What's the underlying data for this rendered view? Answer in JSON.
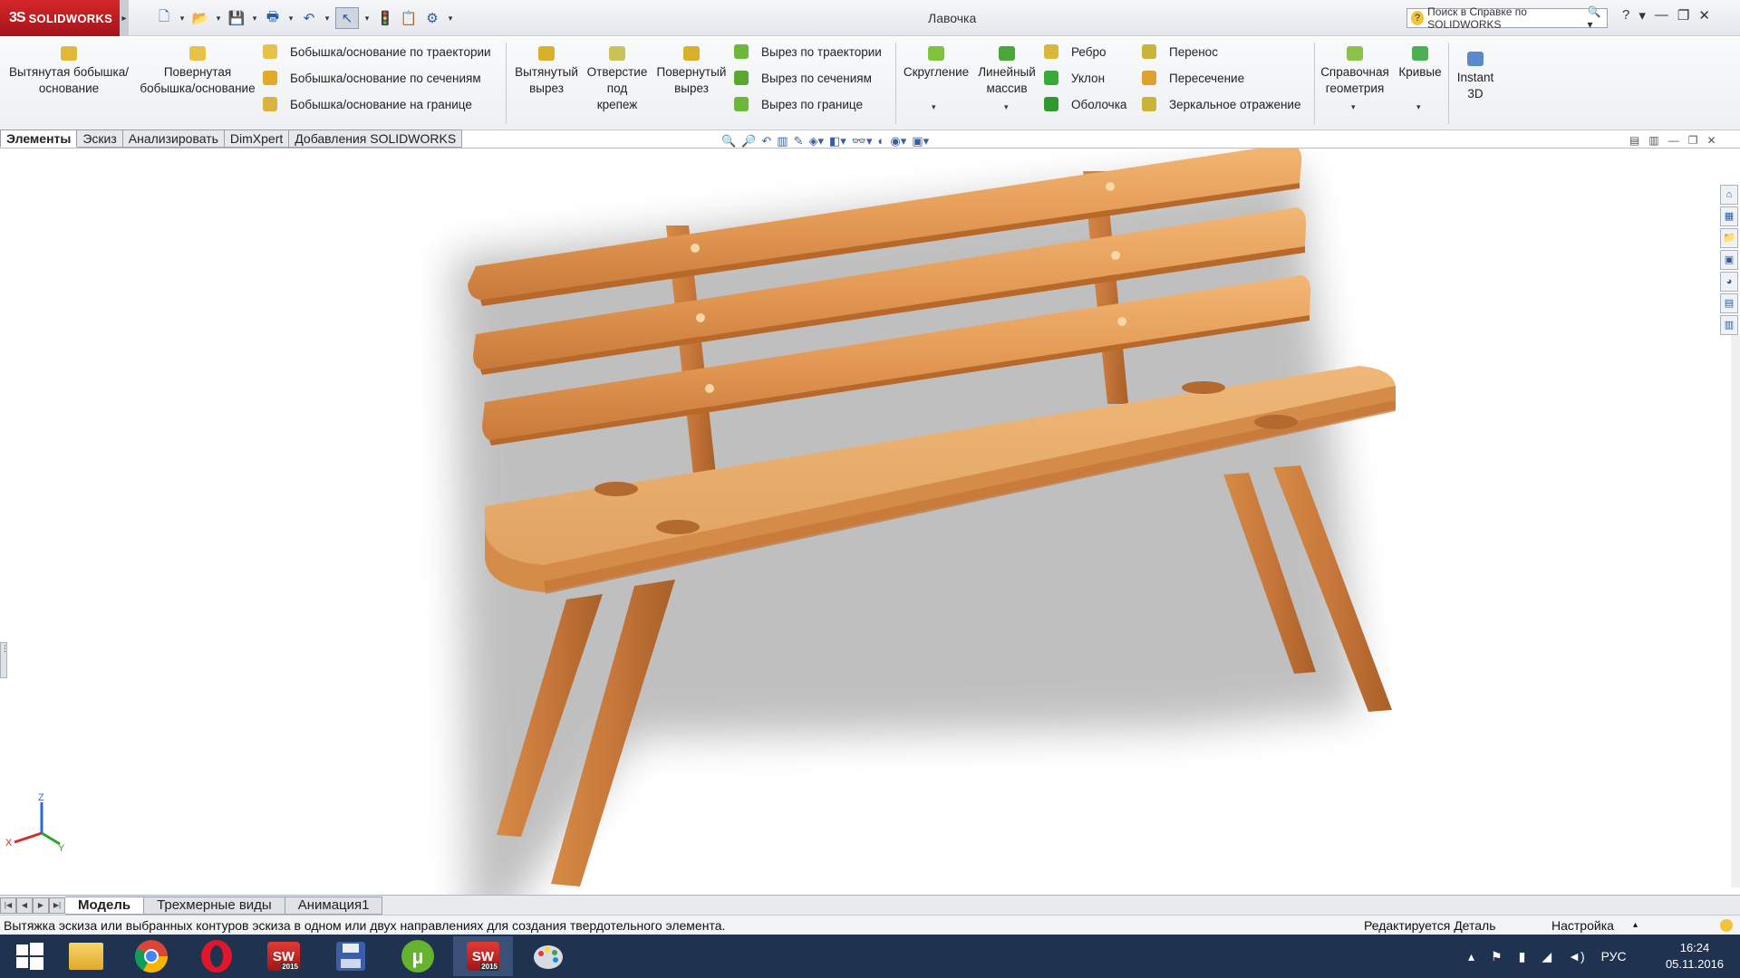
{
  "app": {
    "brand": "SOLIDWORKS",
    "ds_mark": "3S",
    "window_title": "Лавочка",
    "help_placeholder": "Поиск в Справке по SOLIDWORKS",
    "help_q": "?"
  },
  "qat": {
    "new": "🗋",
    "open": "📂",
    "save": "💾",
    "print": "🖶",
    "undo": "↶",
    "select": "↖",
    "rebuild": "🚦",
    "file_props": "📋",
    "options": "⚙"
  },
  "ribbon": {
    "extrude_boss": "Вытянутая бобышка/основание",
    "revolve_boss": "Повернутая бобышка/основание",
    "swept_boss": "Бобышка/основание по траектории",
    "lofted_boss": "Бобышка/основание по сечениям",
    "boundary_boss": "Бобышка/основание на границе",
    "extrude_cut": "Вытянутый вырез",
    "hole_wizard": "Отверстие под крепеж",
    "revolve_cut": "Повернутый вырез",
    "swept_cut": "Вырез по траектории",
    "lofted_cut": "Вырез по сечениям",
    "boundary_cut": "Вырез по границе",
    "fillet": "Скругление",
    "linear_pattern": "Линейный массив",
    "rib": "Ребро",
    "draft": "Уклон",
    "shell": "Оболочка",
    "wrap": "Перенос",
    "intersect": "Пересечение",
    "mirror": "Зеркальное отражение",
    "ref_geometry": "Справочная геометрия",
    "curves": "Кривые",
    "instant3d": "Instant 3D"
  },
  "tabs": [
    "Элементы",
    "Эскиз",
    "Анализировать",
    "DimXpert",
    "Добавления SOLIDWORKS"
  ],
  "triad": {
    "x": "X",
    "y": "Y",
    "z": "Z"
  },
  "bottom_tabs": [
    "Модель",
    "Трехмерные виды",
    "Анимация1"
  ],
  "status": {
    "message": "Вытяжка эскиза или выбранных контуров эскиза в одном или двух направлениях для создания твердотельного элемента.",
    "mode": "Редактируется Деталь",
    "custom": "Настройка"
  },
  "taskbar": {
    "sw_label": "SW",
    "sw_year": "2015",
    "lang": "РУС",
    "time": "16:24",
    "date": "05.11.2016"
  },
  "colors": {
    "wood_light": "#e9a35f",
    "wood_dark": "#b8692a",
    "brand_red": "#c8202a",
    "taskbar": "#1f3250"
  }
}
